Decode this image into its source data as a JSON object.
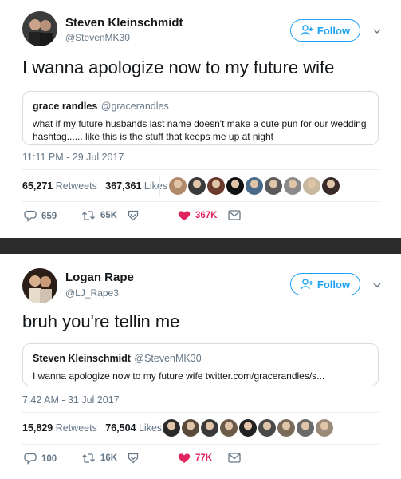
{
  "tweet1": {
    "name": "Steven Kleinschmidt",
    "handle": "@StevenMK30",
    "follow_label": "Follow",
    "text": "I wanna apologize now to my future wife",
    "quote": {
      "name": "grace randles",
      "handle": "@gracerandles",
      "text": "what if my future husbands last name doesn't make a cute pun for our wedding hashtag...... like this is the stuff that keeps me up at night"
    },
    "timestamp": "11:11 PM - 29 Jul 2017",
    "retweets_count": "65,271",
    "retweets_label": "Retweets",
    "likes_count": "367,361",
    "likes_label": "Likes",
    "actions": {
      "reply": "659",
      "retweet": "65K",
      "like": "367K"
    },
    "liker_colors": [
      "#b08a6a",
      "#3a3a3a",
      "#6b3a2a",
      "#111111",
      "#4a6a8a",
      "#5a5a5a",
      "#8a8a8a",
      "#c8b8a0",
      "#3a2a2a"
    ]
  },
  "tweet2": {
    "name": "Logan Rape",
    "handle": "@LJ_Rape3",
    "follow_label": "Follow",
    "text": "bruh you're tellin me",
    "quote": {
      "name": "Steven Kleinschmidt",
      "handle": "@StevenMK30",
      "text": "I wanna apologize now to my future wife twitter.com/gracerandles/s..."
    },
    "timestamp": "7:42 AM - 31 Jul 2017",
    "retweets_count": "15,829",
    "retweets_label": "Retweets",
    "likes_count": "76,504",
    "likes_label": "Likes",
    "actions": {
      "reply": "100",
      "retweet": "16K",
      "like": "77K"
    },
    "liker_colors": [
      "#2a2a2a",
      "#5a4a3a",
      "#3a3a3a",
      "#6a5a4a",
      "#222222",
      "#4a4a4a",
      "#7a6a5a",
      "#6a6a6a",
      "#9a8a7a"
    ]
  },
  "colors": {
    "accent": "#1da1f2",
    "like": "#e0245e",
    "muted": "#657786"
  }
}
